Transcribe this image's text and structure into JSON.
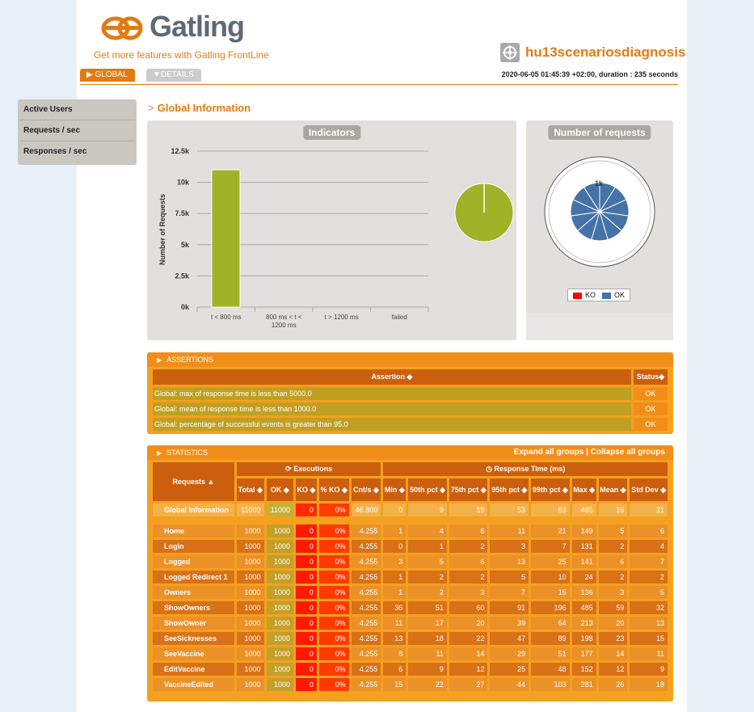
{
  "header": {
    "brand": "Gatling",
    "frontline_link": "Get more features with Gatling FrontLine",
    "simulation_name": "hu13scenariosdiagnosis",
    "run_info": "2020-06-05 01:45:39 +02:00, duration : 235 seconds"
  },
  "tabs": [
    {
      "label": "GLOBAL",
      "active": true
    },
    {
      "label": "DETAILS",
      "active": false
    }
  ],
  "side_menu": [
    "Active Users",
    "Requests / sec",
    "Responses / sec"
  ],
  "section_title": "Global Information",
  "colors": {
    "accent": "#e37a11",
    "ok": "#a0b228",
    "ko": "#ff0000",
    "ok_blue": "#4572a7"
  },
  "indicators_chart": {
    "title": "Indicators",
    "chart_data": {
      "type": "bar",
      "categories": [
        "t < 800 ms",
        "800 ms < t < 1200 ms",
        "t > 1200 ms",
        "failed"
      ],
      "values": [
        11000,
        0,
        0,
        0
      ],
      "ylabel": "Number of Requests",
      "yticks": [
        "0k",
        "2.5k",
        "5k",
        "7.5k",
        "10k",
        "12.5k"
      ],
      "ylim": [
        0,
        12500
      ]
    }
  },
  "requests_chart": {
    "title": "Number of requests",
    "label": "1k",
    "legend": [
      "KO",
      "OK"
    ]
  },
  "assertions": {
    "title": "ASSERTIONS",
    "headers": [
      "Assertion",
      "Status"
    ],
    "rows": [
      [
        "Global: max of response time is less than 5000.0",
        "OK"
      ],
      [
        "Global: mean of response time is less than 1000.0",
        "OK"
      ],
      [
        "Global: percentage of successful events is greater than 95.0",
        "OK"
      ]
    ]
  },
  "statistics": {
    "title": "STATISTICS",
    "expand": "Expand all groups",
    "divider": "|",
    "collapse": "Collapse all groups",
    "group_executions": "Executions",
    "group_response": "Response Time (ms)",
    "headers": [
      "Requests",
      "Total",
      "OK",
      "KO",
      "% KO",
      "Cnt/s",
      "Min",
      "50th pct",
      "75th pct",
      "95th pct",
      "99th pct",
      "Max",
      "Mean",
      "Std Dev"
    ],
    "global_row": [
      "Global Information",
      "11000",
      "11000",
      "0",
      "0%",
      "46.809",
      "0",
      "9",
      "19",
      "53",
      "83",
      "485",
      "16",
      "21"
    ],
    "rows": [
      [
        "Home",
        "1000",
        "1000",
        "0",
        "0%",
        "4.255",
        "1",
        "4",
        "6",
        "11",
        "21",
        "149",
        "5",
        "6"
      ],
      [
        "Login",
        "1000",
        "1000",
        "0",
        "0%",
        "4.255",
        "0",
        "1",
        "2",
        "3",
        "7",
        "131",
        "2",
        "4"
      ],
      [
        "Logged",
        "1000",
        "1000",
        "0",
        "0%",
        "4.255",
        "3",
        "5",
        "6",
        "13",
        "25",
        "141",
        "6",
        "7"
      ],
      [
        "Logged Redirect 1",
        "1000",
        "1000",
        "0",
        "0%",
        "4.255",
        "1",
        "2",
        "2",
        "5",
        "10",
        "24",
        "2",
        "2"
      ],
      [
        "Owners",
        "1000",
        "1000",
        "0",
        "0%",
        "4.255",
        "1",
        "2",
        "3",
        "7",
        "15",
        "136",
        "3",
        "5"
      ],
      [
        "ShowOwners",
        "1000",
        "1000",
        "0",
        "0%",
        "4.255",
        "36",
        "51",
        "60",
        "91",
        "196",
        "485",
        "59",
        "32"
      ],
      [
        "ShowOwner",
        "1000",
        "1000",
        "0",
        "0%",
        "4.255",
        "11",
        "17",
        "20",
        "39",
        "64",
        "213",
        "20",
        "13"
      ],
      [
        "SeeSicknesses",
        "1000",
        "1000",
        "0",
        "0%",
        "4.255",
        "13",
        "18",
        "22",
        "47",
        "89",
        "198",
        "23",
        "15"
      ],
      [
        "SeeVaccine",
        "1000",
        "1000",
        "0",
        "0%",
        "4.255",
        "8",
        "11",
        "14",
        "29",
        "51",
        "177",
        "14",
        "11"
      ],
      [
        "EditVaccine",
        "1000",
        "1000",
        "0",
        "0%",
        "4.255",
        "6",
        "9",
        "12",
        "25",
        "48",
        "152",
        "12",
        "9"
      ],
      [
        "VaccineEdited",
        "1000",
        "1000",
        "0",
        "0%",
        "4.255",
        "15",
        "22",
        "27",
        "44",
        "103",
        "281",
        "26",
        "18"
      ]
    ]
  }
}
